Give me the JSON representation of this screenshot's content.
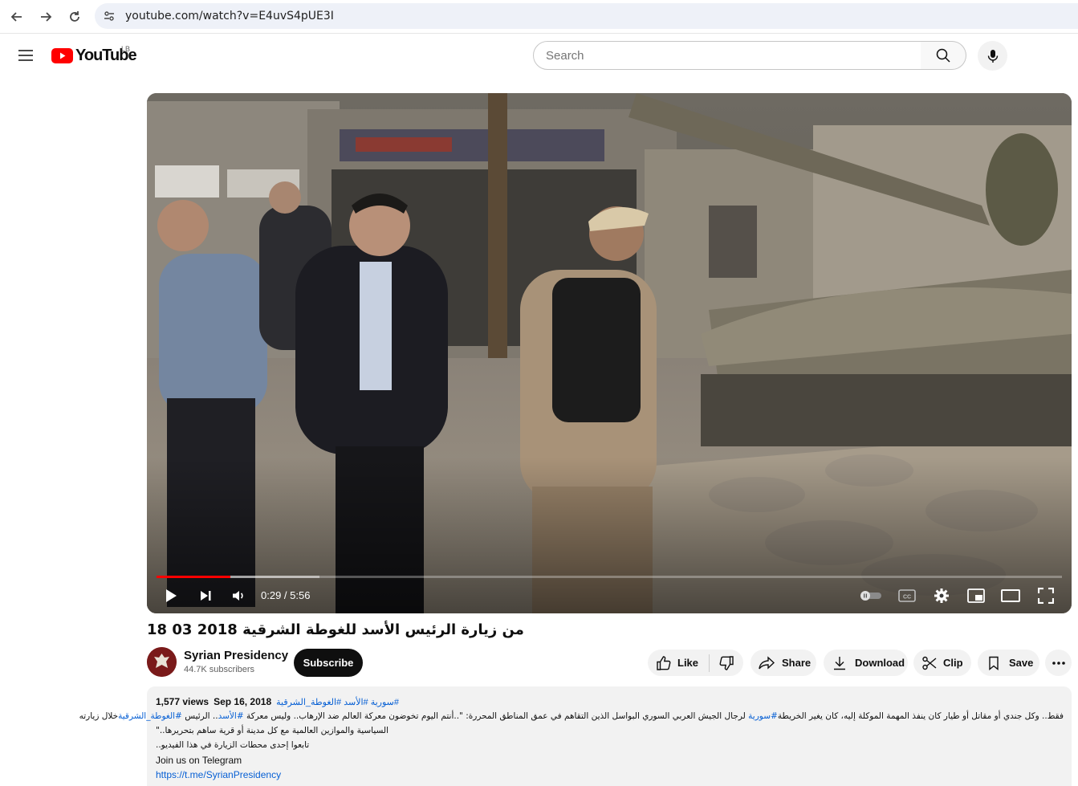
{
  "browser": {
    "url": "youtube.com/watch?v=E4uvS4pUE3I"
  },
  "header": {
    "logo_text": "YouTube",
    "region": "LB",
    "search_placeholder": "Search"
  },
  "player": {
    "time": "0:29 / 5:56",
    "progress_played_fraction": 0.0815,
    "progress_buffered_fraction": 0.18
  },
  "video": {
    "title": "من زيارة الرئيس الأسد للغوطة الشرقية 2018 03 18"
  },
  "channel": {
    "name": "Syrian Presidency",
    "subscribers": "44.7K subscribers",
    "subscribe_label": "Subscribe"
  },
  "actions": {
    "like": "Like",
    "share": "Share",
    "download": "Download",
    "clip": "Clip",
    "save": "Save"
  },
  "description": {
    "views": "1,577 views",
    "date": "Sep 16, 2018",
    "tags": "#سورية #الأسد #الغوطة_الشرقية",
    "line1_a": "فقط.. وكل جندي أو مقاتل أو طيار كان ينفذ المهمة الموكلة إليه، كان يغير الخريطة",
    "line1_tag1": "#سورية",
    "line1_b": " لرجال الجيش العربي السوري البواسل الذين التقاهم في عمق المناطق المحررة: \"..أنتم اليوم تخوضون معركة العالم ضد الإرهاب.. وليس معركة ",
    "line1_tag2": "#الأسد",
    "line1_c": ".. الرئيس ",
    "line1_tag3": "#الغوطة_الشرقية",
    "line1_d": "خلال زيارته ",
    "line2": "السياسية والموازين العالمية مع كل مدينة أو قرية ساهم بتحريرها..\"",
    "line3": "تابعوا إحدى محطات الزيارة في هذا الفيديو..",
    "telegram_label": "Join us on Telegram",
    "telegram_link": "https://t.me/SyrianPresidency"
  },
  "colors": {
    "accent_red": "#ff0000",
    "link_blue": "#065fd4",
    "subscribe_bg": "#0f0f0f",
    "pill_bg": "#f2f2f2"
  }
}
